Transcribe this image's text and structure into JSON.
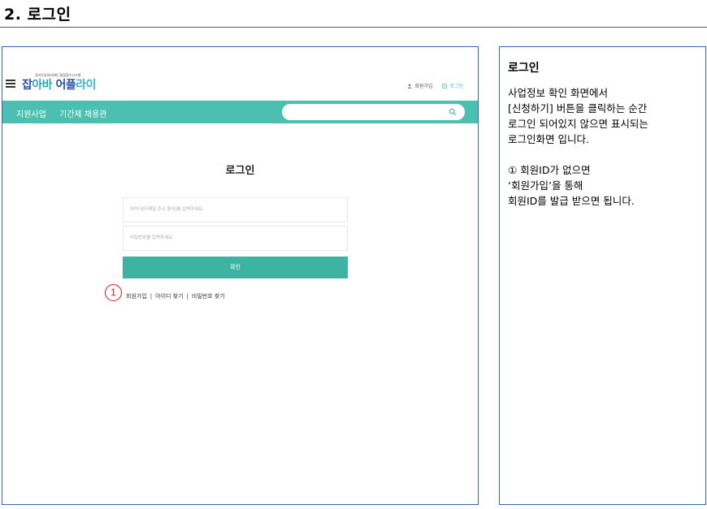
{
  "doc_title": "2. 로그인",
  "screen": {
    "header": {
      "logo_small_text": "경기도일자리재단 통합접수시스템",
      "logo_parts": [
        "잡",
        "아바",
        " 어플",
        "라이"
      ],
      "signup_link": "회원가입",
      "login_link": "로그인"
    },
    "nav": {
      "items": [
        "지원사업",
        "기간제 채용관"
      ],
      "search_value": ""
    },
    "login": {
      "heading": "로그인",
      "id_placeholder": "아이디(이메일 주소 형식)를 입력하세요.",
      "pw_placeholder": "비밀번호를 입력하세요.",
      "confirm_label": "확인",
      "links": [
        "회원가입",
        "아이디 찾기",
        "비밀번호 찾기"
      ],
      "separator": "|",
      "marker": "1"
    }
  },
  "description": {
    "title": "로그인",
    "body": "사업정보 확인 화면에서\n[신청하기] 버튼을 클릭하는 순간\n로그인 되어있지 않으면 표시되는\n로그인화면 입니다.\n\n① 회원ID가 없으면\n‘회원가입’을 통해\n회원ID를 발급 받으면 됩니다."
  },
  "colors": {
    "accent_teal": "#4bbfb0",
    "button_teal": "#3fb3a1",
    "frame_blue": "#3a63b8",
    "marker_red": "#e0141a"
  }
}
